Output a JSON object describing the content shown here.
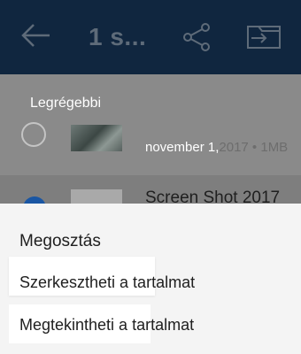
{
  "appbar": {
    "title": "1 s...",
    "back_icon": "back-arrow-icon",
    "share_icon": "share-icon",
    "move_icon": "move-to-folder-icon",
    "background": "#10263f"
  },
  "list": {
    "sort_label": "Legrégebbi",
    "rows": [
      {
        "date": "november 1,",
        "meta": "2017 • 1MB",
        "selected": false
      },
      {
        "title": "Screen Shot 2017",
        "selected": true
      }
    ]
  },
  "sheet": {
    "title": "Megosztás",
    "items": [
      {
        "label": "Szerkesztheti a tartalmat"
      },
      {
        "label": "Megtekintheti a tartalmat"
      }
    ]
  },
  "colors": {
    "accent": "#1a56a3",
    "overlay": "#8a8a8a"
  }
}
